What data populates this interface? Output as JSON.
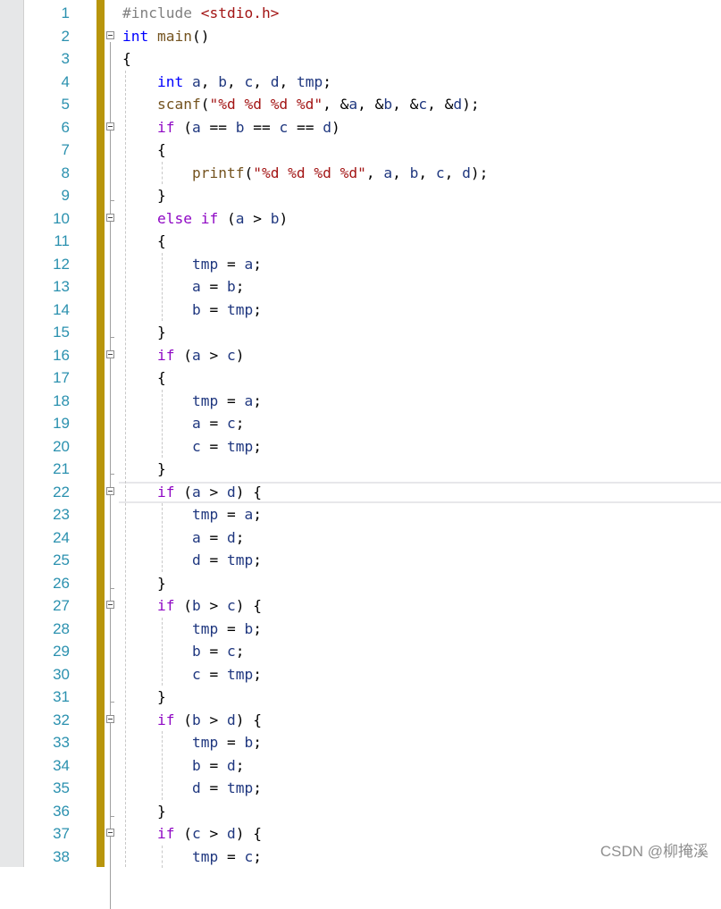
{
  "editor": {
    "lines": [
      {
        "n": "1",
        "fold": false,
        "tokens": [
          {
            "t": "#include ",
            "c": "pre"
          },
          {
            "t": "<stdio.h>",
            "c": "inc"
          }
        ]
      },
      {
        "n": "2",
        "fold": true,
        "tokens": [
          {
            "t": "int",
            "c": "kw"
          },
          {
            "t": " ",
            "c": "pl"
          },
          {
            "t": "main",
            "c": "fn"
          },
          {
            "t": "()",
            "c": "pl"
          }
        ]
      },
      {
        "n": "3",
        "fold": false,
        "tokens": [
          {
            "t": "{",
            "c": "pl"
          }
        ]
      },
      {
        "n": "4",
        "fold": false,
        "tokens": [
          {
            "t": "    ",
            "c": "pl"
          },
          {
            "t": "int",
            "c": "kw"
          },
          {
            "t": " ",
            "c": "pl"
          },
          {
            "t": "a",
            "c": "var"
          },
          {
            "t": ", ",
            "c": "pl"
          },
          {
            "t": "b",
            "c": "var"
          },
          {
            "t": ", ",
            "c": "pl"
          },
          {
            "t": "c",
            "c": "var"
          },
          {
            "t": ", ",
            "c": "pl"
          },
          {
            "t": "d",
            "c": "var"
          },
          {
            "t": ", ",
            "c": "pl"
          },
          {
            "t": "tmp",
            "c": "var"
          },
          {
            "t": ";",
            "c": "pl"
          }
        ]
      },
      {
        "n": "5",
        "fold": false,
        "tokens": [
          {
            "t": "    ",
            "c": "pl"
          },
          {
            "t": "scanf",
            "c": "fn"
          },
          {
            "t": "(",
            "c": "pl"
          },
          {
            "t": "\"%d %d %d %d\"",
            "c": "str"
          },
          {
            "t": ", &",
            "c": "pl"
          },
          {
            "t": "a",
            "c": "var"
          },
          {
            "t": ", &",
            "c": "pl"
          },
          {
            "t": "b",
            "c": "var"
          },
          {
            "t": ", &",
            "c": "pl"
          },
          {
            "t": "c",
            "c": "var"
          },
          {
            "t": ", &",
            "c": "pl"
          },
          {
            "t": "d",
            "c": "var"
          },
          {
            "t": ");",
            "c": "pl"
          }
        ]
      },
      {
        "n": "6",
        "fold": true,
        "tokens": [
          {
            "t": "    ",
            "c": "pl"
          },
          {
            "t": "if",
            "c": "ctl"
          },
          {
            "t": " (",
            "c": "pl"
          },
          {
            "t": "a",
            "c": "var"
          },
          {
            "t": " == ",
            "c": "pl"
          },
          {
            "t": "b",
            "c": "var"
          },
          {
            "t": " == ",
            "c": "pl"
          },
          {
            "t": "c",
            "c": "var"
          },
          {
            "t": " == ",
            "c": "pl"
          },
          {
            "t": "d",
            "c": "var"
          },
          {
            "t": ")",
            "c": "pl"
          }
        ]
      },
      {
        "n": "7",
        "fold": false,
        "tokens": [
          {
            "t": "    {",
            "c": "pl"
          }
        ]
      },
      {
        "n": "8",
        "fold": false,
        "tokens": [
          {
            "t": "        ",
            "c": "pl"
          },
          {
            "t": "printf",
            "c": "fn"
          },
          {
            "t": "(",
            "c": "pl"
          },
          {
            "t": "\"%d %d %d %d\"",
            "c": "str"
          },
          {
            "t": ", ",
            "c": "pl"
          },
          {
            "t": "a",
            "c": "var"
          },
          {
            "t": ", ",
            "c": "pl"
          },
          {
            "t": "b",
            "c": "var"
          },
          {
            "t": ", ",
            "c": "pl"
          },
          {
            "t": "c",
            "c": "var"
          },
          {
            "t": ", ",
            "c": "pl"
          },
          {
            "t": "d",
            "c": "var"
          },
          {
            "t": ");",
            "c": "pl"
          }
        ]
      },
      {
        "n": "9",
        "fold": false,
        "tokens": [
          {
            "t": "    }",
            "c": "pl"
          }
        ]
      },
      {
        "n": "10",
        "fold": true,
        "tokens": [
          {
            "t": "    ",
            "c": "pl"
          },
          {
            "t": "else",
            "c": "ctl"
          },
          {
            "t": " ",
            "c": "pl"
          },
          {
            "t": "if",
            "c": "ctl"
          },
          {
            "t": " (",
            "c": "pl"
          },
          {
            "t": "a",
            "c": "var"
          },
          {
            "t": " > ",
            "c": "pl"
          },
          {
            "t": "b",
            "c": "var"
          },
          {
            "t": ")",
            "c": "pl"
          }
        ]
      },
      {
        "n": "11",
        "fold": false,
        "tokens": [
          {
            "t": "    {",
            "c": "pl"
          }
        ]
      },
      {
        "n": "12",
        "fold": false,
        "tokens": [
          {
            "t": "        ",
            "c": "pl"
          },
          {
            "t": "tmp",
            "c": "var"
          },
          {
            "t": " = ",
            "c": "pl"
          },
          {
            "t": "a",
            "c": "var"
          },
          {
            "t": ";",
            "c": "pl"
          }
        ]
      },
      {
        "n": "13",
        "fold": false,
        "tokens": [
          {
            "t": "        ",
            "c": "pl"
          },
          {
            "t": "a",
            "c": "var"
          },
          {
            "t": " = ",
            "c": "pl"
          },
          {
            "t": "b",
            "c": "var"
          },
          {
            "t": ";",
            "c": "pl"
          }
        ]
      },
      {
        "n": "14",
        "fold": false,
        "tokens": [
          {
            "t": "        ",
            "c": "pl"
          },
          {
            "t": "b",
            "c": "var"
          },
          {
            "t": " = ",
            "c": "pl"
          },
          {
            "t": "tmp",
            "c": "var"
          },
          {
            "t": ";",
            "c": "pl"
          }
        ]
      },
      {
        "n": "15",
        "fold": false,
        "tokens": [
          {
            "t": "    }",
            "c": "pl"
          }
        ]
      },
      {
        "n": "16",
        "fold": true,
        "tokens": [
          {
            "t": "    ",
            "c": "pl"
          },
          {
            "t": "if",
            "c": "ctl"
          },
          {
            "t": " (",
            "c": "pl"
          },
          {
            "t": "a",
            "c": "var"
          },
          {
            "t": " > ",
            "c": "pl"
          },
          {
            "t": "c",
            "c": "var"
          },
          {
            "t": ")",
            "c": "pl"
          }
        ]
      },
      {
        "n": "17",
        "fold": false,
        "tokens": [
          {
            "t": "    {",
            "c": "pl"
          }
        ]
      },
      {
        "n": "18",
        "fold": false,
        "tokens": [
          {
            "t": "        ",
            "c": "pl"
          },
          {
            "t": "tmp",
            "c": "var"
          },
          {
            "t": " = ",
            "c": "pl"
          },
          {
            "t": "a",
            "c": "var"
          },
          {
            "t": ";",
            "c": "pl"
          }
        ]
      },
      {
        "n": "19",
        "fold": false,
        "tokens": [
          {
            "t": "        ",
            "c": "pl"
          },
          {
            "t": "a",
            "c": "var"
          },
          {
            "t": " = ",
            "c": "pl"
          },
          {
            "t": "c",
            "c": "var"
          },
          {
            "t": ";",
            "c": "pl"
          }
        ]
      },
      {
        "n": "20",
        "fold": false,
        "tokens": [
          {
            "t": "        ",
            "c": "pl"
          },
          {
            "t": "c",
            "c": "var"
          },
          {
            "t": " = ",
            "c": "pl"
          },
          {
            "t": "tmp",
            "c": "var"
          },
          {
            "t": ";",
            "c": "pl"
          }
        ]
      },
      {
        "n": "21",
        "fold": false,
        "tokens": [
          {
            "t": "    }",
            "c": "pl"
          }
        ]
      },
      {
        "n": "22",
        "fold": true,
        "tokens": [
          {
            "t": "    ",
            "c": "pl"
          },
          {
            "t": "if",
            "c": "ctl"
          },
          {
            "t": " (",
            "c": "pl"
          },
          {
            "t": "a",
            "c": "var"
          },
          {
            "t": " > ",
            "c": "pl"
          },
          {
            "t": "d",
            "c": "var"
          },
          {
            "t": ") {",
            "c": "pl"
          }
        ]
      },
      {
        "n": "23",
        "fold": false,
        "tokens": [
          {
            "t": "        ",
            "c": "pl"
          },
          {
            "t": "tmp",
            "c": "var"
          },
          {
            "t": " = ",
            "c": "pl"
          },
          {
            "t": "a",
            "c": "var"
          },
          {
            "t": ";",
            "c": "pl"
          }
        ]
      },
      {
        "n": "24",
        "fold": false,
        "tokens": [
          {
            "t": "        ",
            "c": "pl"
          },
          {
            "t": "a",
            "c": "var"
          },
          {
            "t": " = ",
            "c": "pl"
          },
          {
            "t": "d",
            "c": "var"
          },
          {
            "t": ";",
            "c": "pl"
          }
        ]
      },
      {
        "n": "25",
        "fold": false,
        "tokens": [
          {
            "t": "        ",
            "c": "pl"
          },
          {
            "t": "d",
            "c": "var"
          },
          {
            "t": " = ",
            "c": "pl"
          },
          {
            "t": "tmp",
            "c": "var"
          },
          {
            "t": ";",
            "c": "pl"
          }
        ]
      },
      {
        "n": "26",
        "fold": false,
        "tokens": [
          {
            "t": "    }",
            "c": "pl"
          }
        ]
      },
      {
        "n": "27",
        "fold": true,
        "tokens": [
          {
            "t": "    ",
            "c": "pl"
          },
          {
            "t": "if",
            "c": "ctl"
          },
          {
            "t": " (",
            "c": "pl"
          },
          {
            "t": "b",
            "c": "var"
          },
          {
            "t": " > ",
            "c": "pl"
          },
          {
            "t": "c",
            "c": "var"
          },
          {
            "t": ") {",
            "c": "pl"
          }
        ]
      },
      {
        "n": "28",
        "fold": false,
        "tokens": [
          {
            "t": "        ",
            "c": "pl"
          },
          {
            "t": "tmp",
            "c": "var"
          },
          {
            "t": " = ",
            "c": "pl"
          },
          {
            "t": "b",
            "c": "var"
          },
          {
            "t": ";",
            "c": "pl"
          }
        ]
      },
      {
        "n": "29",
        "fold": false,
        "tokens": [
          {
            "t": "        ",
            "c": "pl"
          },
          {
            "t": "b",
            "c": "var"
          },
          {
            "t": " = ",
            "c": "pl"
          },
          {
            "t": "c",
            "c": "var"
          },
          {
            "t": ";",
            "c": "pl"
          }
        ]
      },
      {
        "n": "30",
        "fold": false,
        "tokens": [
          {
            "t": "        ",
            "c": "pl"
          },
          {
            "t": "c",
            "c": "var"
          },
          {
            "t": " = ",
            "c": "pl"
          },
          {
            "t": "tmp",
            "c": "var"
          },
          {
            "t": ";",
            "c": "pl"
          }
        ]
      },
      {
        "n": "31",
        "fold": false,
        "tokens": [
          {
            "t": "    }",
            "c": "pl"
          }
        ]
      },
      {
        "n": "32",
        "fold": true,
        "tokens": [
          {
            "t": "    ",
            "c": "pl"
          },
          {
            "t": "if",
            "c": "ctl"
          },
          {
            "t": " (",
            "c": "pl"
          },
          {
            "t": "b",
            "c": "var"
          },
          {
            "t": " > ",
            "c": "pl"
          },
          {
            "t": "d",
            "c": "var"
          },
          {
            "t": ") {",
            "c": "pl"
          }
        ]
      },
      {
        "n": "33",
        "fold": false,
        "tokens": [
          {
            "t": "        ",
            "c": "pl"
          },
          {
            "t": "tmp",
            "c": "var"
          },
          {
            "t": " = ",
            "c": "pl"
          },
          {
            "t": "b",
            "c": "var"
          },
          {
            "t": ";",
            "c": "pl"
          }
        ]
      },
      {
        "n": "34",
        "fold": false,
        "tokens": [
          {
            "t": "        ",
            "c": "pl"
          },
          {
            "t": "b",
            "c": "var"
          },
          {
            "t": " = ",
            "c": "pl"
          },
          {
            "t": "d",
            "c": "var"
          },
          {
            "t": ";",
            "c": "pl"
          }
        ]
      },
      {
        "n": "35",
        "fold": false,
        "tokens": [
          {
            "t": "        ",
            "c": "pl"
          },
          {
            "t": "d",
            "c": "var"
          },
          {
            "t": " = ",
            "c": "pl"
          },
          {
            "t": "tmp",
            "c": "var"
          },
          {
            "t": ";",
            "c": "pl"
          }
        ]
      },
      {
        "n": "36",
        "fold": false,
        "tokens": [
          {
            "t": "    }",
            "c": "pl"
          }
        ]
      },
      {
        "n": "37",
        "fold": true,
        "tokens": [
          {
            "t": "    ",
            "c": "pl"
          },
          {
            "t": "if",
            "c": "ctl"
          },
          {
            "t": " (",
            "c": "pl"
          },
          {
            "t": "c",
            "c": "var"
          },
          {
            "t": " > ",
            "c": "pl"
          },
          {
            "t": "d",
            "c": "var"
          },
          {
            "t": ") {",
            "c": "pl"
          }
        ]
      },
      {
        "n": "38",
        "fold": false,
        "tokens": [
          {
            "t": "        ",
            "c": "pl"
          },
          {
            "t": "tmp",
            "c": "var"
          },
          {
            "t": " = ",
            "c": "pl"
          },
          {
            "t": "c",
            "c": "var"
          },
          {
            "t": ";",
            "c": "pl"
          }
        ]
      }
    ],
    "current_line": "22"
  },
  "colors": {
    "line_number": "#2b91af",
    "keyword": "#0000ff",
    "control_keyword": "#8f08c4",
    "string": "#a31515",
    "preprocessor": "#808080",
    "change_bar": "#b8950c"
  },
  "watermark": {
    "text": "CSDN @柳掩溪"
  }
}
